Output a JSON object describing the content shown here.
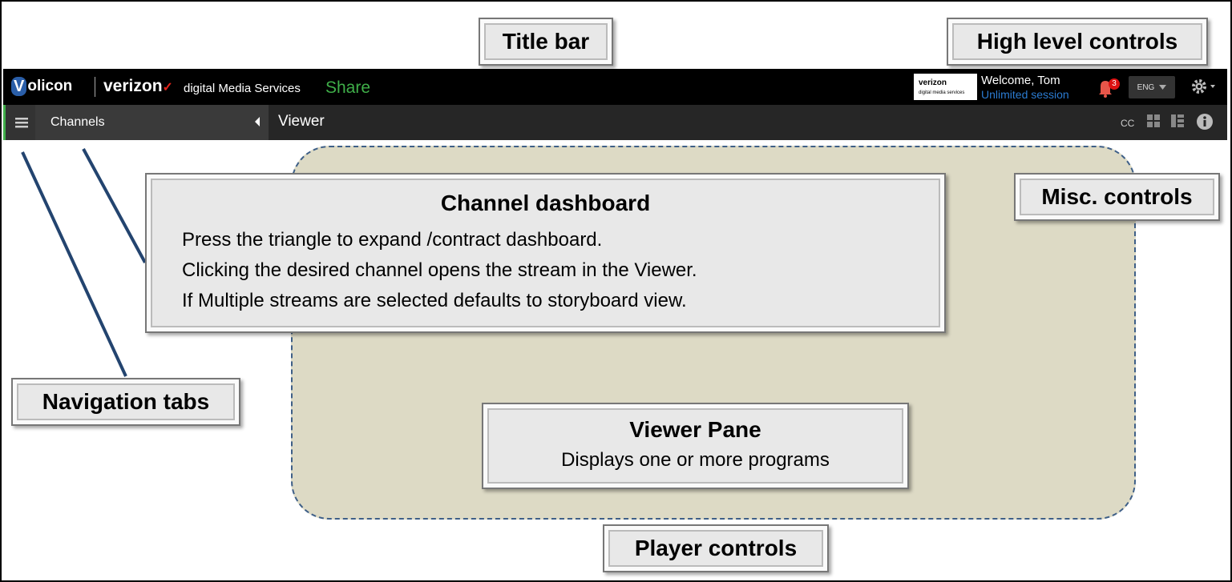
{
  "titlebar": {
    "brand_initial": "V",
    "brand_rest": "olicon",
    "partner": "verizon",
    "partner_mark": "✓",
    "product": "digital Media Services",
    "module": "Share",
    "partner_box_title": "verizon",
    "partner_box_sub": "digital media services",
    "welcome": "Welcome, Tom",
    "session": "Unlimited session",
    "notification_count": "3",
    "language": "ENG"
  },
  "navbar": {
    "channels_label": "Channels",
    "viewer_label": "Viewer",
    "cc_label": "CC"
  },
  "annotations": {
    "title_bar": "Title bar",
    "high_level_controls": "High level controls",
    "misc_controls": "Misc. controls",
    "navigation_tabs": "Navigation tabs",
    "player_controls": "Player controls",
    "channel_dashboard": {
      "title": "Channel dashboard",
      "lines": [
        "Press the triangle to expand /contract dashboard.",
        "Clicking the desired channel opens the stream in the Viewer.",
        "If Multiple streams are selected defaults to storyboard view."
      ]
    },
    "viewer_pane": {
      "title": "Viewer Pane",
      "subtitle": "Displays one or more programs"
    }
  },
  "colors": {
    "titlebar_bg": "#000000",
    "navbar_bg": "#262626",
    "share_green": "#3fae49",
    "session_blue": "#2b7bd1",
    "verizon_red": "#e2231a",
    "pane_bg": "#dddac5",
    "pane_border": "#3e5f87"
  }
}
